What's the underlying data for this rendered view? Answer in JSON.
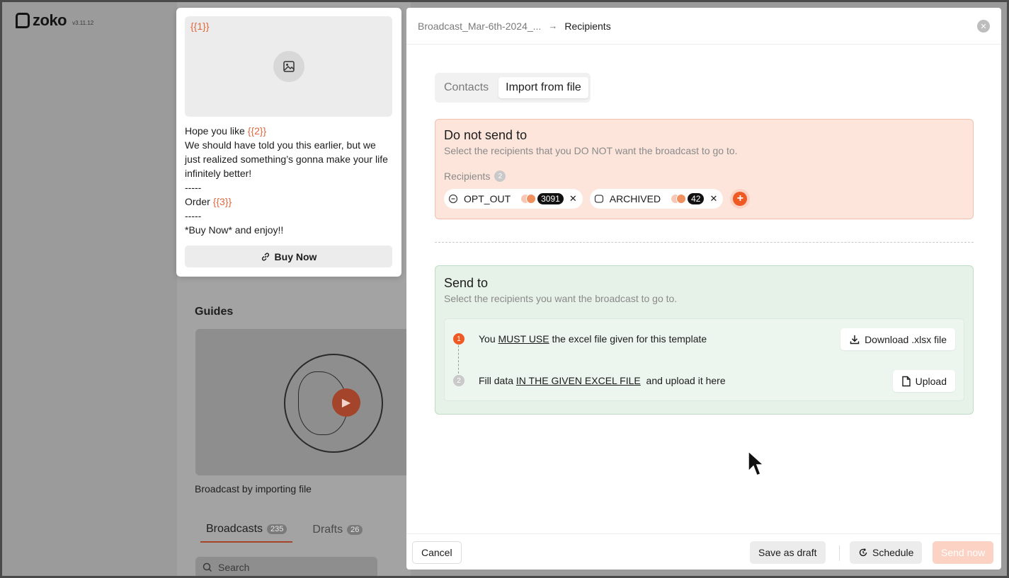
{
  "app": {
    "name": "zoko",
    "version": "v3.11.12"
  },
  "background": {
    "guides_title": "Guides",
    "guide_caption": "Broadcast by importing file",
    "tabs": [
      {
        "label": "Broadcasts",
        "count": "235"
      },
      {
        "label": "Drafts",
        "count": "26"
      }
    ],
    "search_placeholder": "Search"
  },
  "preview": {
    "media_var": "{{1}}",
    "line1_prefix": "Hope you like ",
    "line1_var": "{{2}}",
    "line2": "We should have told you this earlier, but we just realized something’s gonna make your life infinitely better!",
    "sep1": "-----",
    "order_prefix": "Order ",
    "order_var": "{{3}}",
    "sep2": "-----",
    "closing": "*Buy Now* and enjoy!!",
    "cta_label": "Buy Now"
  },
  "modal": {
    "breadcrumb_prev": "Broadcast_Mar-6th-2024_...",
    "breadcrumb_current": "Recipients",
    "tabs": [
      {
        "label": "Contacts",
        "active": false
      },
      {
        "label": "Import from file",
        "active": true
      }
    ],
    "dont_send": {
      "title": "Do not send to",
      "subtitle": "Select the recipients that you DO NOT want the broadcast to go to.",
      "recipients_label": "Recipients",
      "recipients_count": "2",
      "chips": [
        {
          "label": "OPT_OUT",
          "count": "3091"
        },
        {
          "label": "ARCHIVED",
          "count": "42"
        }
      ]
    },
    "send_to": {
      "title": "Send to",
      "subtitle": "Select the recipients you want the broadcast to go to.",
      "step1": {
        "num": "1",
        "pre": "You ",
        "emph": "MUST USE",
        "post": " the excel file given for this template",
        "button": "Download .xlsx file"
      },
      "step2": {
        "num": "2",
        "pre": "Fill data ",
        "emph": "IN THE GIVEN EXCEL FILE",
        "post": "  and upload it here",
        "button": "Upload"
      }
    },
    "footer": {
      "cancel": "Cancel",
      "save_draft": "Save as draft",
      "schedule": "Schedule",
      "send_now": "Send now"
    }
  },
  "colors": {
    "accent": "#ef5a24",
    "dont_send_bg": "#fde5dc",
    "send_to_bg": "#e6f1e8"
  }
}
